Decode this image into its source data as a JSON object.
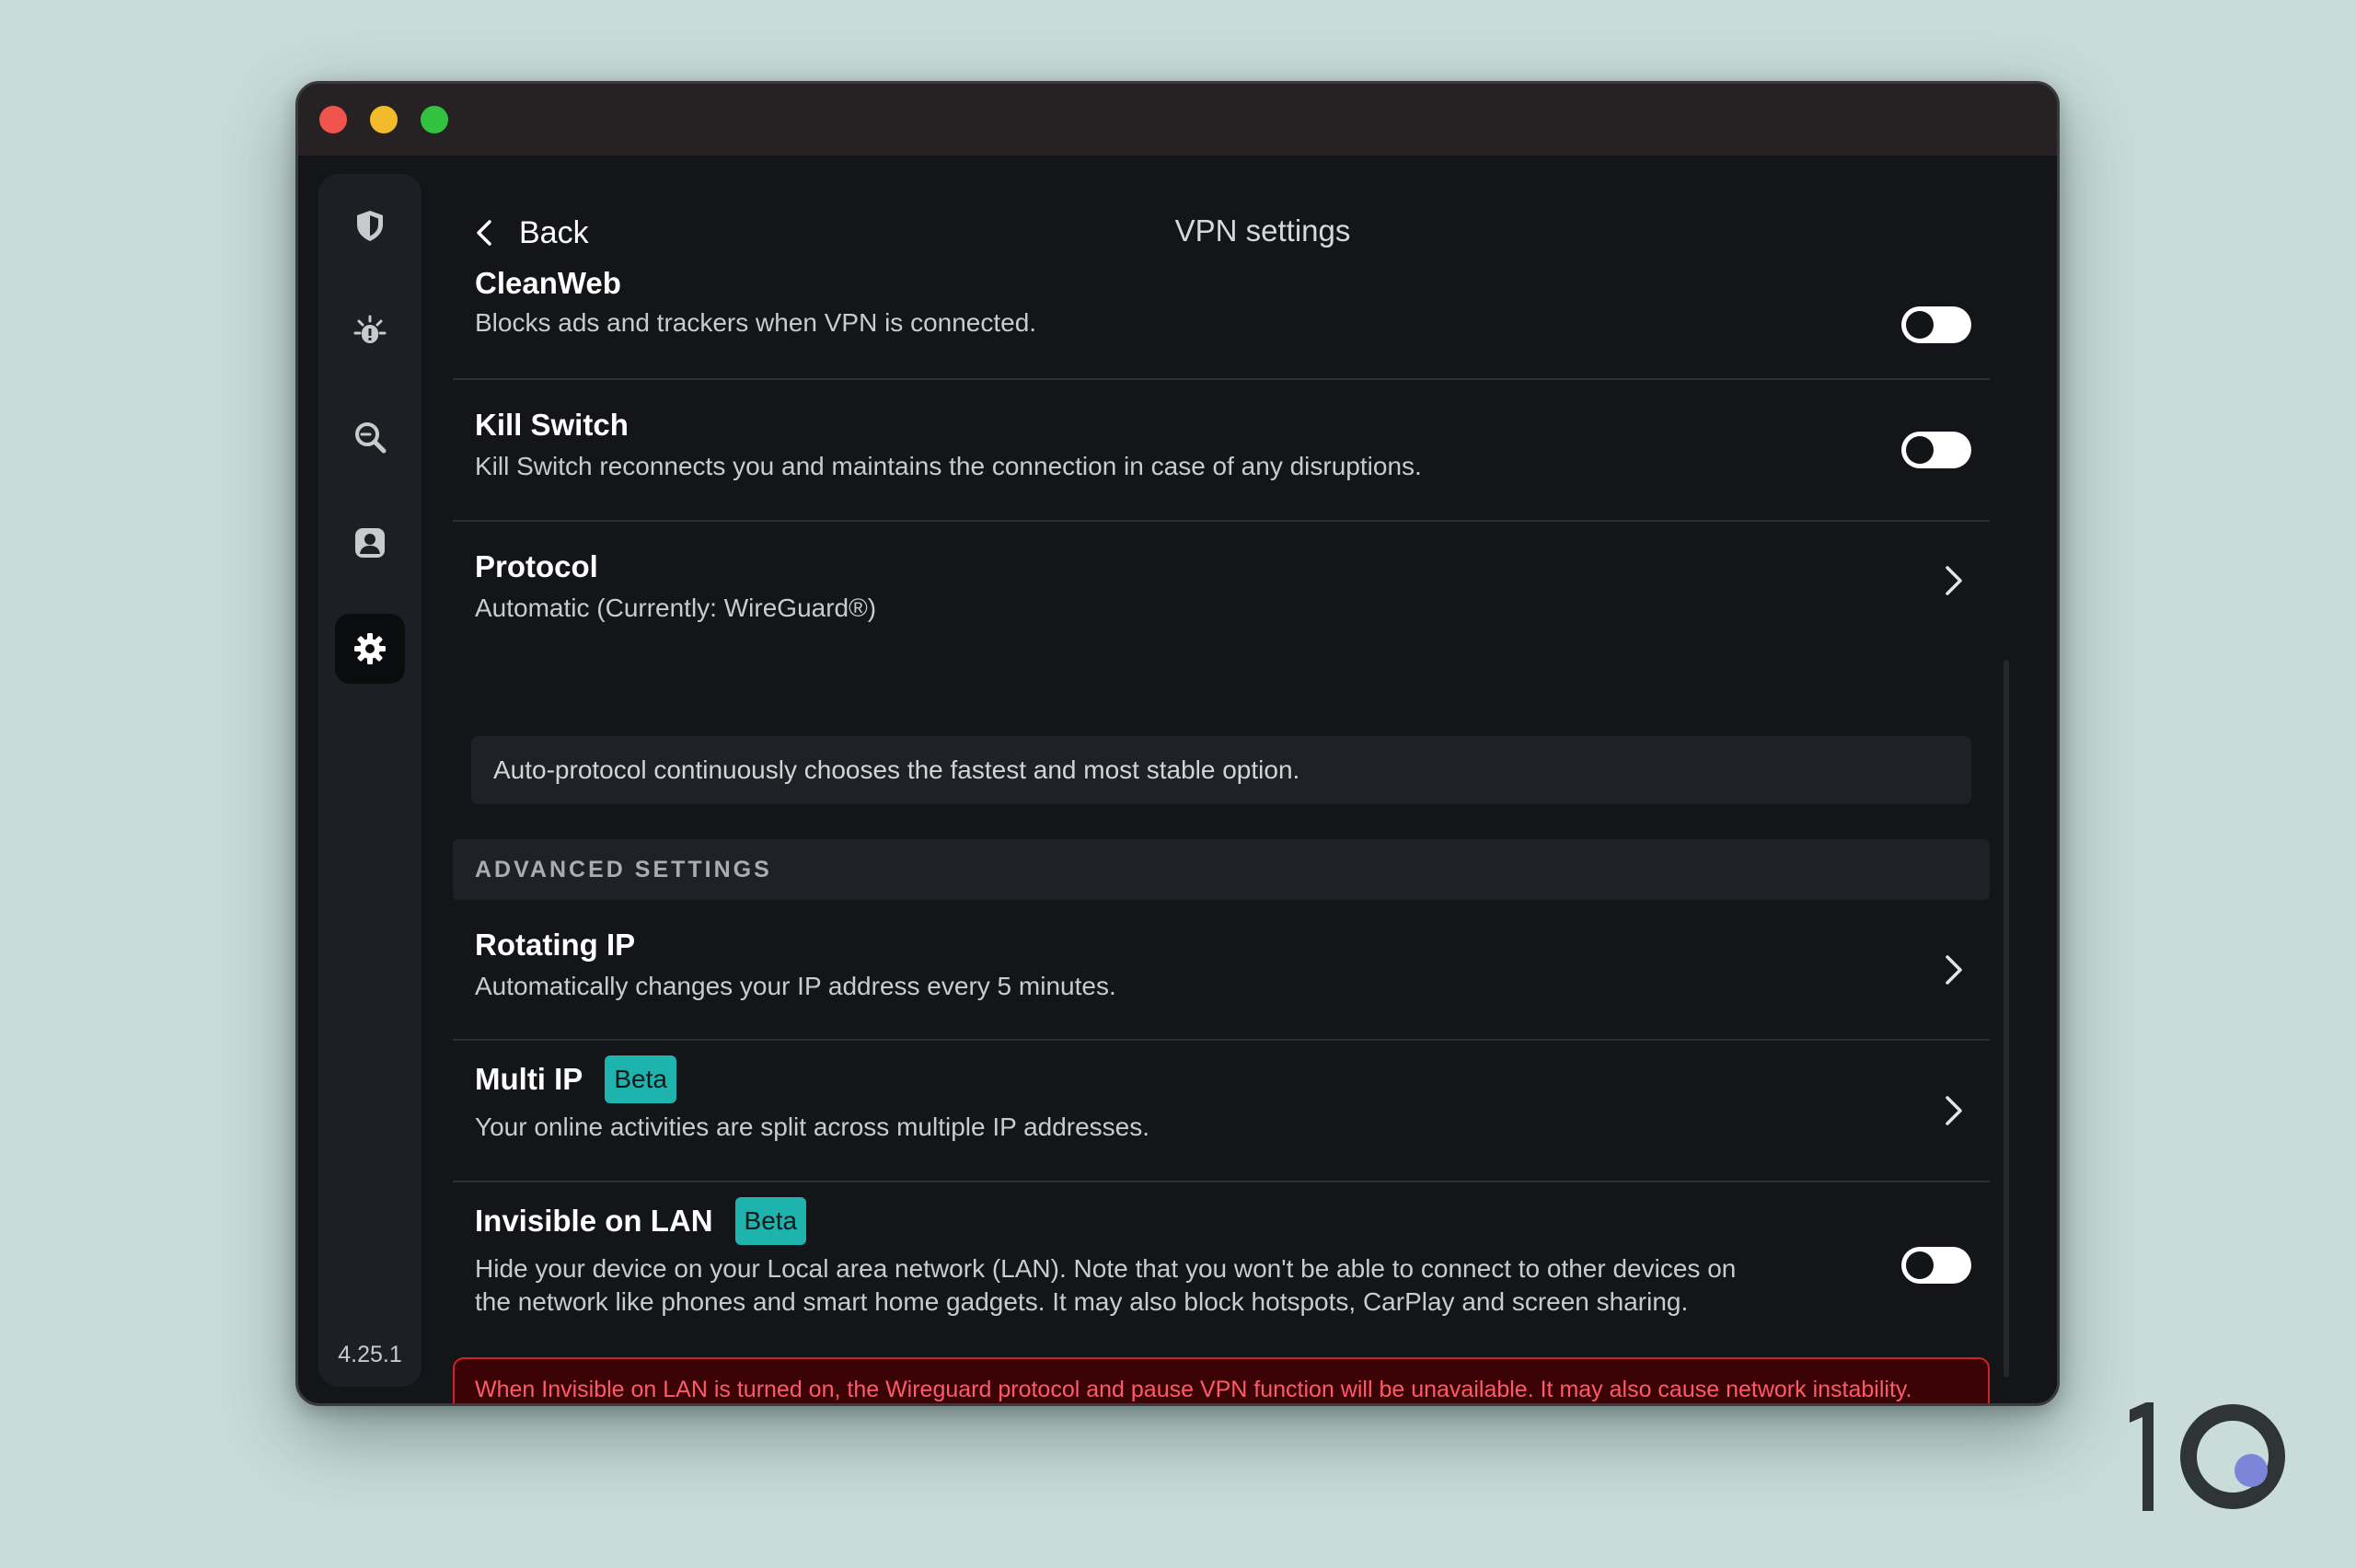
{
  "app": {
    "version": "4.25.1"
  },
  "nav": {
    "back_label": "Back",
    "page_title": "VPN settings",
    "sidebar_icons": [
      "shield-icon",
      "alert-bug-icon",
      "search-icon",
      "account-icon",
      "gear-icon"
    ],
    "active": "gear-icon"
  },
  "settings": {
    "cleanweb": {
      "title": "CleanWeb",
      "desc": "Blocks ads and trackers when VPN is connected.",
      "enabled": false
    },
    "kill_switch": {
      "title": "Kill Switch",
      "desc": "Kill Switch reconnects you and maintains the connection in case of any disruptions.",
      "enabled": false
    },
    "protocol": {
      "title": "Protocol",
      "desc": "Automatic (Currently: WireGuard®)",
      "info": "Auto-protocol continuously chooses the fastest and most stable option."
    },
    "advanced_header": "ADVANCED SETTINGS",
    "rotating_ip": {
      "title": "Rotating IP",
      "desc": "Automatically changes your IP address every 5 minutes."
    },
    "multi_ip": {
      "title": "Multi IP",
      "badge": "Beta",
      "desc": "Your online activities are split across multiple IP addresses."
    },
    "invisible_lan": {
      "title": "Invisible on LAN",
      "badge": "Beta",
      "desc_line1": "Hide your device on your Local area network (LAN). Note that you won't be able to connect to other devices on",
      "desc_line2": "the network like phones and smart home gadgets. It may also block hotspots, CarPlay and screen sharing.",
      "enabled": false,
      "warning": "When Invisible on LAN is turned on, the Wireguard protocol and pause VPN function will be unavailable. It may also cause network instability."
    }
  },
  "colors": {
    "accent_badge": "#1fb3ae",
    "warning_border": "#d0222d",
    "warning_text": "#ff5a67",
    "window_bg": "#131518",
    "page_bg": "#c9dcd9"
  }
}
